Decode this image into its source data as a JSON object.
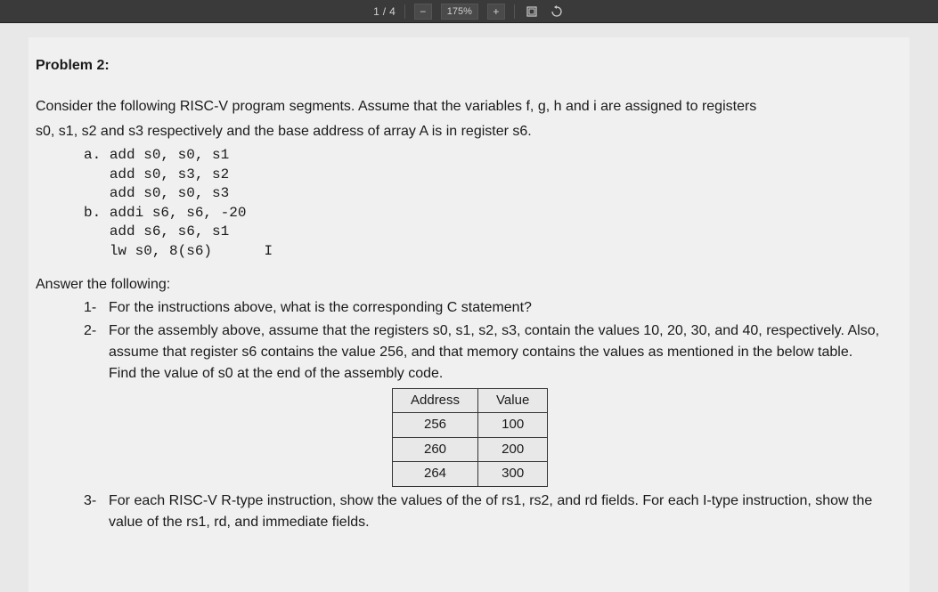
{
  "toolbar": {
    "page_current": "1",
    "page_total": "4",
    "zoom_value": "175%",
    "minus": "−",
    "plus": "+"
  },
  "problem": {
    "title": "Problem 2:",
    "intro_line1": "Consider the following RISC-V program segments. Assume that the variables f, g, h and i are assigned to registers",
    "intro_line2": "s0, s1, s2 and s3 respectively and the base address of array A is in register s6.",
    "code_a_label": "a.",
    "code_a_line1": "add s0, s0, s1",
    "code_a_line2": "add s0, s3, s2",
    "code_a_line3": "add s0, s0, s3",
    "code_b_label": "b.",
    "code_b_line1": "addi s6, s6, -20",
    "code_b_line2": "add s6, s6, s1",
    "code_b_line3": "lw s0, 8(s6)",
    "cursor_char": "I",
    "answer_header": "Answer the following:",
    "q1_num": "1-",
    "q1_text": "For the instructions above, what is the corresponding C statement?",
    "q2_num": "2-",
    "q2_text_p1": "For the assembly above, assume that the registers s0, s1, s2, s3, contain the values 10, 20, 30, and 40, respectively. Also, assume that register s6 contains the value 256, and that memory contains the values as mentioned in the below table.",
    "q2_text_p2": "Find the value of s0 at the end of the assembly code.",
    "q3_num": "3-",
    "q3_text": "For each RISC-V R-type instruction, show the values of the of rs1, rs2, and rd fields. For each I-type instruction, show the value of the rs1, rd, and immediate fields.",
    "table": {
      "header_address": "Address",
      "header_value": "Value",
      "rows": [
        {
          "address": "256",
          "value": "100"
        },
        {
          "address": "260",
          "value": "200"
        },
        {
          "address": "264",
          "value": "300"
        }
      ]
    }
  }
}
